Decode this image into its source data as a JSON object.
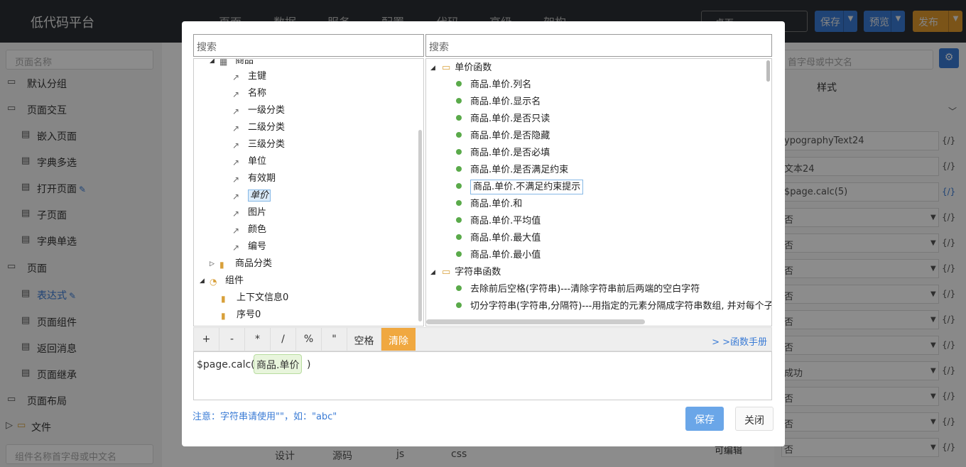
{
  "app": {
    "title": "低代码平台"
  },
  "topmenu": [
    "页面",
    "数据",
    "服务",
    "配置",
    "代码",
    "高级",
    "架构"
  ],
  "top_select": "- 桌面 -",
  "top_buttons": {
    "save": "保存",
    "preview": "预览",
    "publish": "发布"
  },
  "left": {
    "search_placeholder": "页面名称",
    "tree": [
      {
        "label": "默认分组",
        "type": "group"
      },
      {
        "label": "页面交互",
        "type": "group"
      },
      {
        "label": "嵌入页面",
        "type": "leaf"
      },
      {
        "label": "字典多选",
        "type": "leaf"
      },
      {
        "label": "打开页面",
        "type": "leaf"
      },
      {
        "label": "子页面",
        "type": "leaf"
      },
      {
        "label": "字典单选",
        "type": "leaf"
      },
      {
        "label": "页面",
        "type": "group"
      },
      {
        "label": "表达式",
        "type": "leaf"
      },
      {
        "label": "页面组件",
        "type": "leaf"
      },
      {
        "label": "返回消息",
        "type": "leaf"
      },
      {
        "label": "页面继承",
        "type": "leaf"
      },
      {
        "label": "页面布局",
        "type": "group"
      }
    ],
    "file_node": "文件",
    "component_search_placeholder": "组件名称首字母或中文名"
  },
  "bottom_tabs": [
    "设计",
    "源码",
    "js",
    "css"
  ],
  "right": {
    "search_placeholder": "首字母或中文名",
    "tab_style": "样式",
    "props": [
      "ypographyText24",
      "文本24",
      "$page.calc(5)",
      "否",
      "否",
      "否",
      "否",
      "否",
      "否",
      "成功",
      "否",
      "否",
      "否"
    ],
    "last_label": "可编辑"
  },
  "dialog": {
    "left_search_placeholder": "搜索",
    "right_search_placeholder": "搜索",
    "left_tree": {
      "parent": "商品",
      "fields": [
        "主键",
        "名称",
        "一级分类",
        "二级分类",
        "三级分类",
        "单位",
        "有效期",
        "单价",
        "图片",
        "颜色",
        "编号"
      ],
      "selected": "单价",
      "category": "商品分类",
      "components": "组件",
      "component_items": [
        "上下文信息0",
        "序号0"
      ]
    },
    "right_tree": {
      "group1": "单价函数",
      "items1": [
        "商品.单价.列名",
        "商品.单价.显示名",
        "商品.单价.是否只读",
        "商品.单价.是否隐藏",
        "商品.单价.是否必填",
        "商品.单价.是否满足约束",
        "商品.单价.不满足约束提示",
        "商品.单价.和",
        "商品.单价.平均值",
        "商品.单价.最大值",
        "商品.单价.最小值"
      ],
      "highlighted": "商品.单价.不满足约束提示",
      "group2": "字符串函数",
      "items2": [
        "去除前后空格(字符串)---清除字符串前后两端的空白字符",
        "切分字符串(字符串,分隔符)---用指定的元素分隔成字符串数组, 并对每个子"
      ]
    },
    "toolbar": {
      "ops": [
        "+",
        "-",
        "*",
        "/",
        "%",
        "\""
      ],
      "space": "空格",
      "clear": "清除",
      "manual": "> >函数手册"
    },
    "expression": {
      "prefix": "$page.calc(",
      "token": "商品.单价",
      "suffix": ")"
    },
    "notice": "注意：字符串请使用\"\"，如：\"abc\"",
    "save": "保存",
    "close": "关闭"
  }
}
